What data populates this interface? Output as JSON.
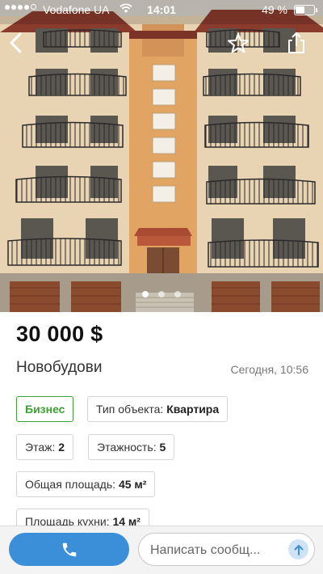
{
  "status_bar": {
    "carrier": "Vodafone UA",
    "time": "14:01",
    "battery": "49 %",
    "battery_level": 0.49
  },
  "icons": {
    "back": "back-arrow-icon",
    "favorite": "star-icon",
    "share": "share-icon",
    "call": "phone-icon",
    "send": "send-arrow-icon"
  },
  "gallery": {
    "pages": 3,
    "active_page": 1
  },
  "listing": {
    "price": "30 000 $",
    "category": "Новобудови",
    "date": "Сегодня, 10:56"
  },
  "tags": {
    "business": "Бизнес",
    "object_type_label": "Тип объекта:",
    "object_type_value": "Квартира",
    "floor_label": "Этаж:",
    "floor_value": "2",
    "floors_label": "Этажность:",
    "floors_value": "5",
    "area_label": "Общая площадь:",
    "area_value": "45 м²",
    "kitchen_label": "Площадь кухни:",
    "kitchen_value": "14 м²"
  },
  "bottom_bar": {
    "message_placeholder": "Написать сообщ..."
  },
  "colors": {
    "accent_blue": "#3a8fd8",
    "business_green": "#3e9f36",
    "facade": "#e8d3b2",
    "facade_orange": "#e2a463",
    "roof": "#8b3b2c"
  }
}
